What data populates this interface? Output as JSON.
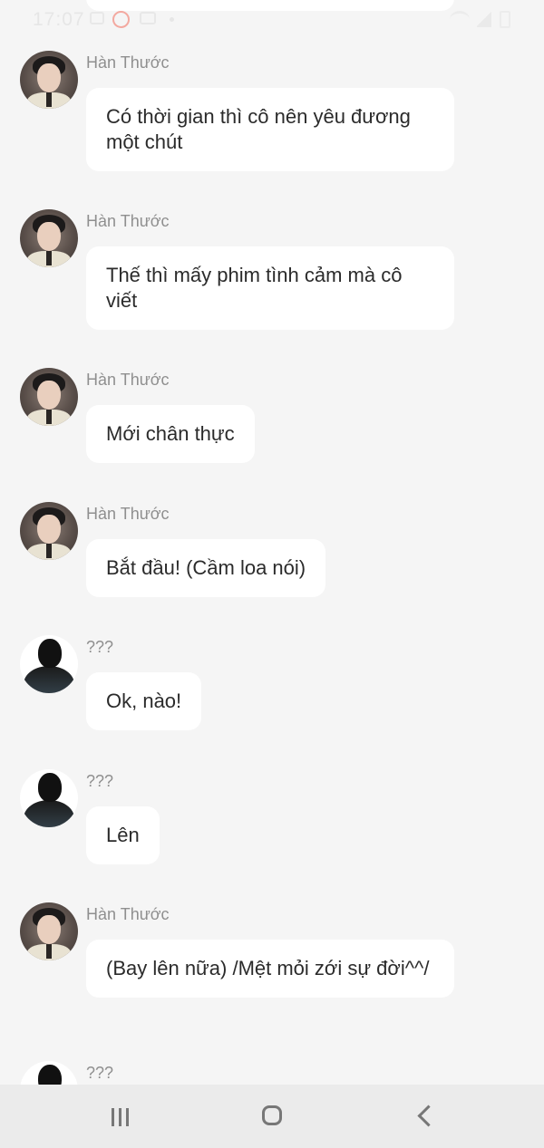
{
  "status_bar": {
    "time": "17:07"
  },
  "messages": [
    {
      "sender": "Hàn Thước",
      "avatar": "han-thuoc-avatar",
      "text": "Có thời gian thì cô nên yêu đương một chút"
    },
    {
      "sender": "Hàn Thước",
      "avatar": "han-thuoc-avatar",
      "text": "Thế thì mấy phim tình cảm mà cô viết"
    },
    {
      "sender": "Hàn Thước",
      "avatar": "han-thuoc-avatar",
      "text": "Mới chân thực"
    },
    {
      "sender": "Hàn Thước",
      "avatar": "han-thuoc-avatar",
      "text": "Bắt đầu! (Cầm loa nói)"
    },
    {
      "sender": "???",
      "avatar": "silhouette-avatar",
      "text": "Ok, nào!"
    },
    {
      "sender": "???",
      "avatar": "silhouette-avatar",
      "text": "Lên"
    },
    {
      "sender": "Hàn Thước",
      "avatar": "han-thuoc-avatar",
      "text": "(Bay lên nữa) /Mệt mỏi zới sự đời^^/"
    },
    {
      "sender": "???",
      "avatar": "silhouette-avatar",
      "text": ""
    }
  ],
  "nav_bar": {
    "recent_icon": "recent-apps-icon",
    "home_icon": "home-icon",
    "back_icon": "back-icon"
  }
}
